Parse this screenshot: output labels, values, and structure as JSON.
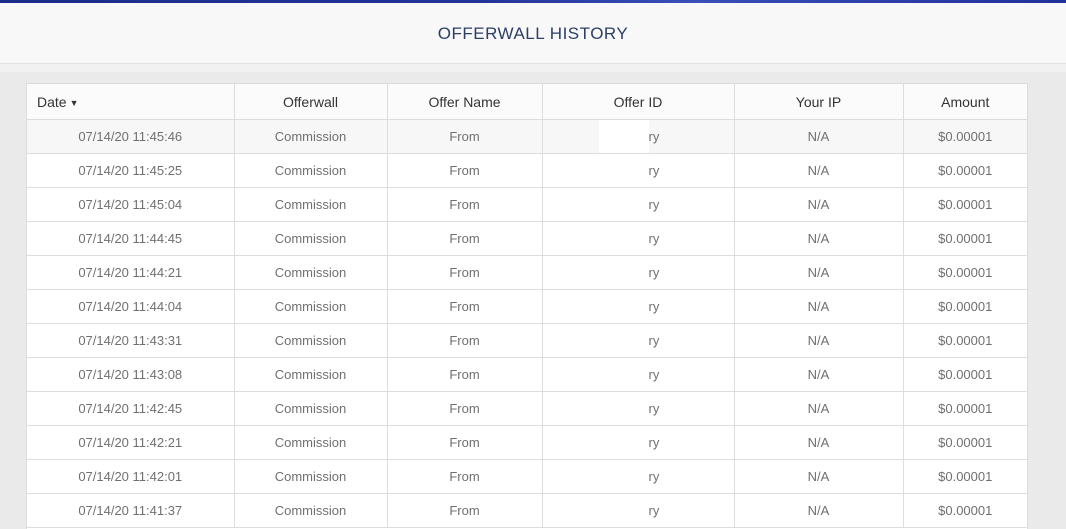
{
  "page": {
    "title": "OFFERWALL HISTORY"
  },
  "table": {
    "columns": [
      "Date",
      "Offerwall",
      "Offer Name",
      "Offer ID",
      "Your IP",
      "Amount"
    ],
    "sort_indicator": "▼",
    "rows": [
      {
        "date": "07/14/20 11:45:46",
        "offerwall": "Commission",
        "offer_name": "From",
        "offer_id": "ry",
        "ip": "N/A",
        "amount": "$0.00001"
      },
      {
        "date": "07/14/20 11:45:25",
        "offerwall": "Commission",
        "offer_name": "From",
        "offer_id": "ry",
        "ip": "N/A",
        "amount": "$0.00001"
      },
      {
        "date": "07/14/20 11:45:04",
        "offerwall": "Commission",
        "offer_name": "From",
        "offer_id": "ry",
        "ip": "N/A",
        "amount": "$0.00001"
      },
      {
        "date": "07/14/20 11:44:45",
        "offerwall": "Commission",
        "offer_name": "From",
        "offer_id": "ry",
        "ip": "N/A",
        "amount": "$0.00001"
      },
      {
        "date": "07/14/20 11:44:21",
        "offerwall": "Commission",
        "offer_name": "From",
        "offer_id": "ry",
        "ip": "N/A",
        "amount": "$0.00001"
      },
      {
        "date": "07/14/20 11:44:04",
        "offerwall": "Commission",
        "offer_name": "From",
        "offer_id": "ry",
        "ip": "N/A",
        "amount": "$0.00001"
      },
      {
        "date": "07/14/20 11:43:31",
        "offerwall": "Commission",
        "offer_name": "From",
        "offer_id": "ry",
        "ip": "N/A",
        "amount": "$0.00001"
      },
      {
        "date": "07/14/20 11:43:08",
        "offerwall": "Commission",
        "offer_name": "From",
        "offer_id": "ry",
        "ip": "N/A",
        "amount": "$0.00001"
      },
      {
        "date": "07/14/20 11:42:45",
        "offerwall": "Commission",
        "offer_name": "From",
        "offer_id": "ry",
        "ip": "N/A",
        "amount": "$0.00001"
      },
      {
        "date": "07/14/20 11:42:21",
        "offerwall": "Commission",
        "offer_name": "From",
        "offer_id": "ry",
        "ip": "N/A",
        "amount": "$0.00001"
      },
      {
        "date": "07/14/20 11:42:01",
        "offerwall": "Commission",
        "offer_name": "From",
        "offer_id": "ry",
        "ip": "N/A",
        "amount": "$0.00001"
      },
      {
        "date": "07/14/20 11:41:37",
        "offerwall": "Commission",
        "offer_name": "From",
        "offer_id": "ry",
        "ip": "N/A",
        "amount": "$0.00001"
      }
    ]
  },
  "colors": {
    "header_text": "#2c3e66",
    "top_bar": "#24349a"
  }
}
